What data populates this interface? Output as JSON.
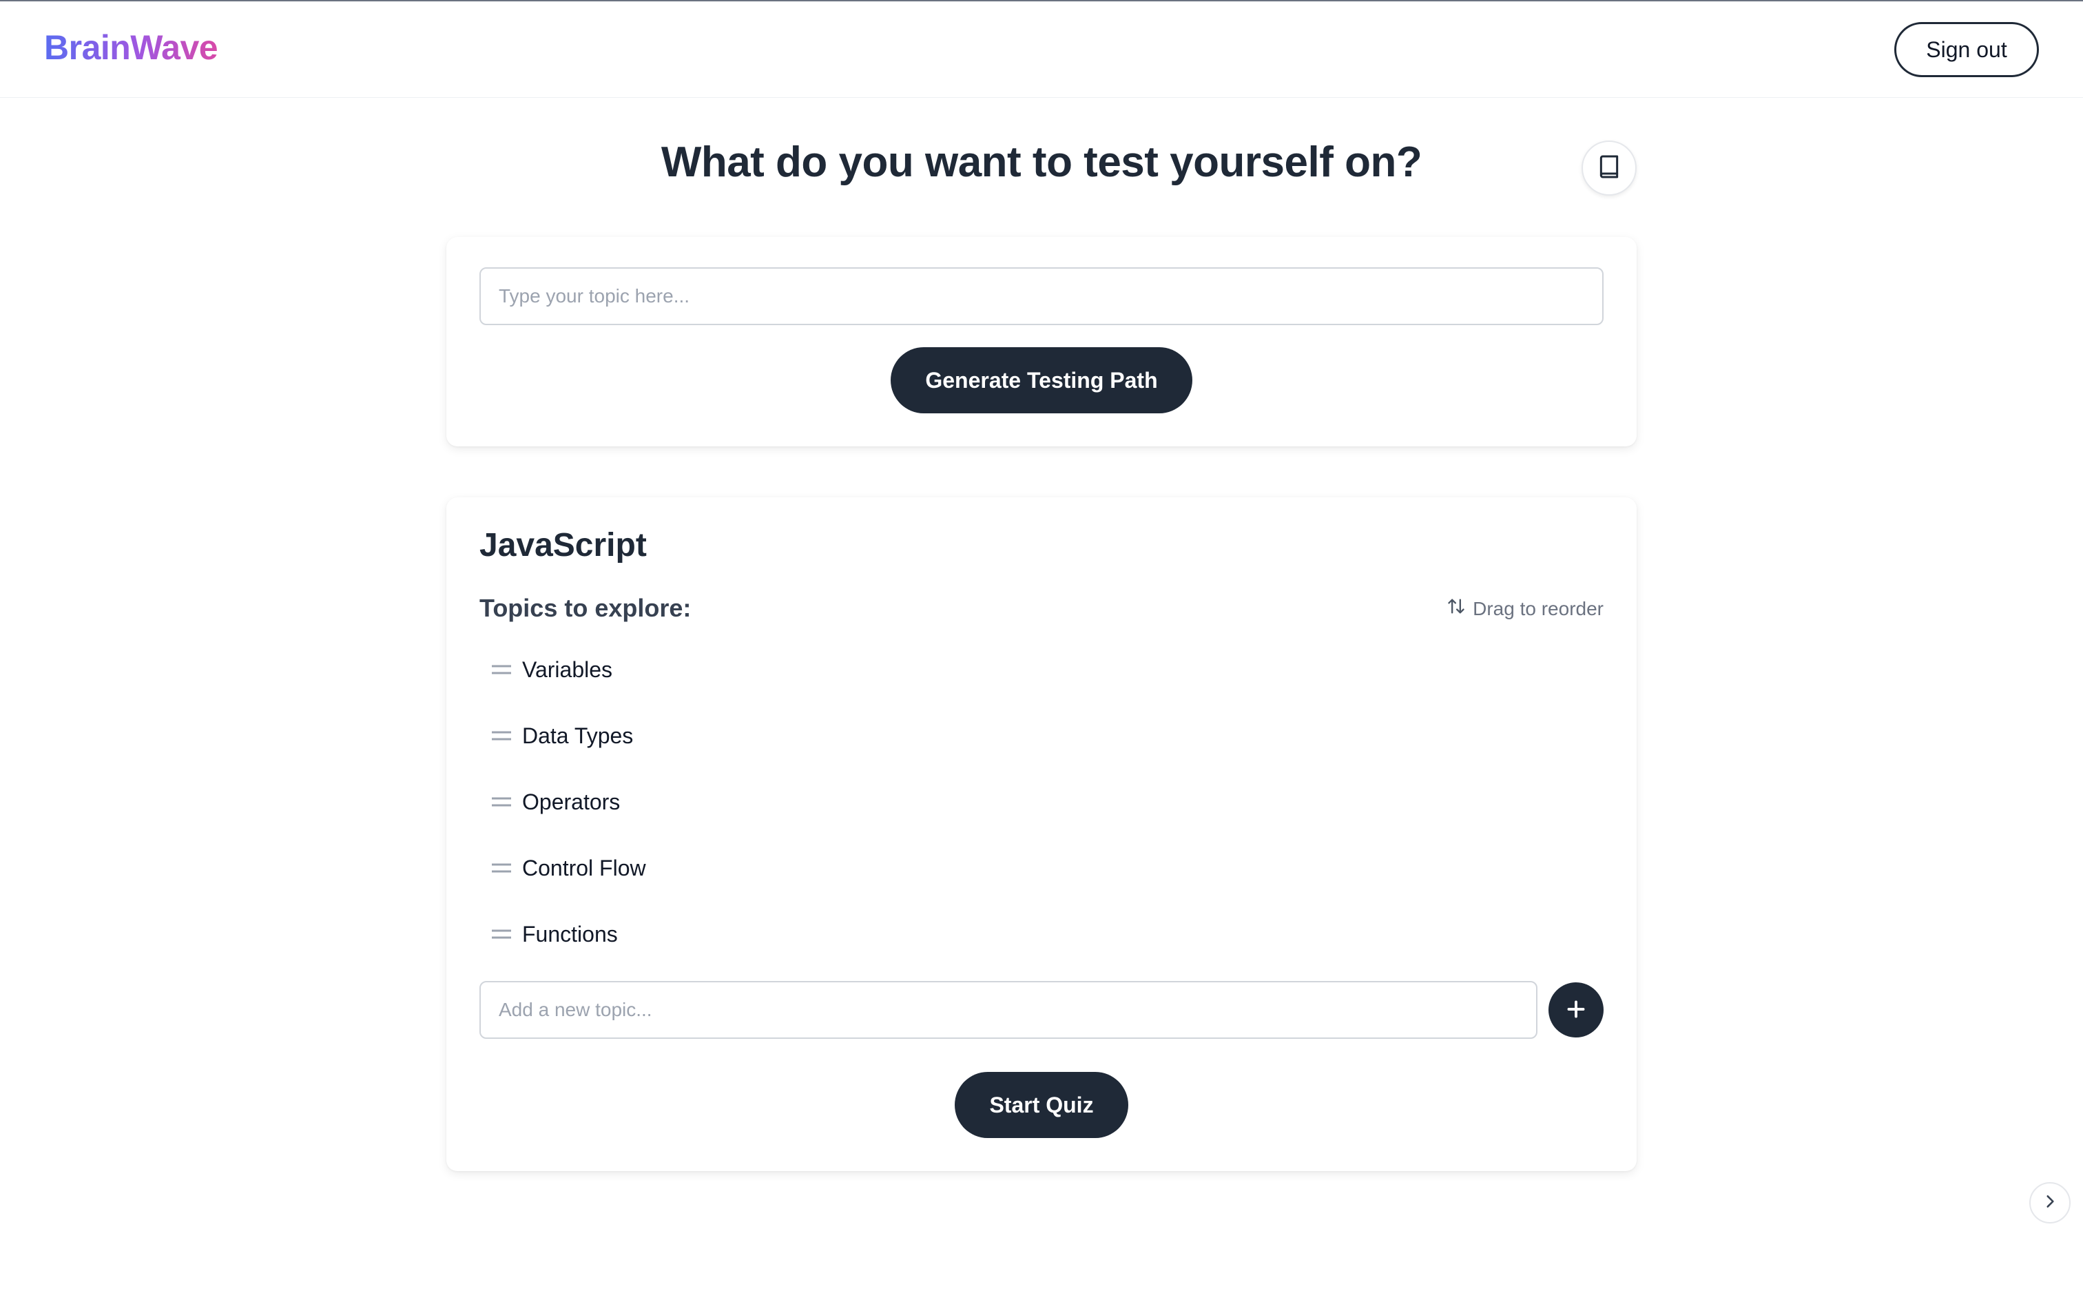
{
  "header": {
    "logo": "BrainWave",
    "sign_out_label": "Sign out"
  },
  "main": {
    "title": "What do you want to test yourself on?",
    "book_icon": "book-icon",
    "topic_input": {
      "value": "",
      "placeholder": "Type your topic here..."
    },
    "generate_label": "Generate Testing Path"
  },
  "path": {
    "subject": "JavaScript",
    "explore_heading": "Topics to explore:",
    "reorder_hint": "Drag to reorder",
    "topics": [
      {
        "label": "Variables"
      },
      {
        "label": "Data Types"
      },
      {
        "label": "Operators"
      },
      {
        "label": "Control Flow"
      },
      {
        "label": "Functions"
      }
    ],
    "add_input": {
      "value": "",
      "placeholder": "Add a new topic..."
    },
    "start_label": "Start Quiz"
  },
  "colors": {
    "primary_dark": "#1f2937",
    "logo_gradient": [
      "#5b6cf0",
      "#a057e0",
      "#d84aa8"
    ],
    "muted_text": "#6b7280"
  }
}
